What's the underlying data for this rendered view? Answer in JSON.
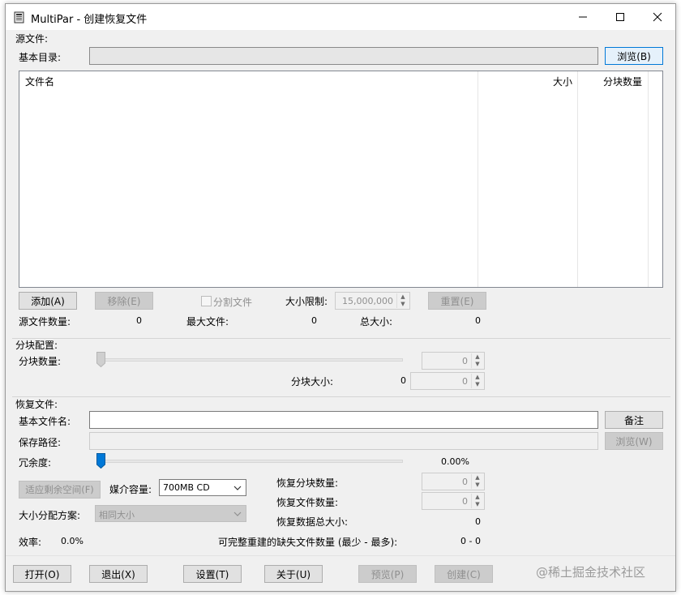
{
  "window": {
    "title": "MultiPar - 创建恢复文件",
    "controls": {
      "minimize": "—",
      "maximize": "☐",
      "close": "✕"
    }
  },
  "source": {
    "section_label": "源文件:",
    "base_dir_label": "基本目录:",
    "base_dir_value": "",
    "browse_button": "浏览(B)",
    "columns": {
      "name": "文件名",
      "size": "大小",
      "blocks": "分块数量"
    },
    "add_button": "添加(A)",
    "remove_button": "移除(E)",
    "split_checkbox_label": "分割文件",
    "size_limit_label": "大小限制:",
    "size_limit_value": "15,000,000",
    "reset_button": "重置(E)",
    "count_label": "源文件数量:",
    "count_value": "0",
    "max_file_label": "最大文件:",
    "max_file_value": "0",
    "total_size_label": "总大小:",
    "total_size_value": "0"
  },
  "blocks": {
    "section_label": "分块配置:",
    "count_label": "分块数量:",
    "count_spin_value": "0",
    "block_size_label": "分块大小:",
    "block_size_value": "0",
    "block_size_spin_value": "0",
    "slider_level": 0
  },
  "recovery": {
    "section_label": "恢复文件:",
    "base_name_label": "基本文件名:",
    "base_name_value": "",
    "note_button": "备注",
    "save_path_label": "保存路径:",
    "save_path_value": "",
    "browse_button": "浏览(W)",
    "redundancy_label": "冗余度:",
    "redundancy_value": "0.00%",
    "redundancy_level": 0,
    "fit_button": "适应剩余空间(F)",
    "media_label": "媒介容量:",
    "media_value": "700MB CD",
    "alloc_label": "大小分配方案:",
    "alloc_value": "相同大小",
    "rec_blocks_label": "恢复分块数量:",
    "rec_blocks_value": "0",
    "rec_files_label": "恢复文件数量:",
    "rec_files_value": "0",
    "rec_total_label": "恢复数据总大小:",
    "rec_total_value": "0",
    "efficiency_label": "效率:",
    "efficiency_value": "0.0%",
    "missing_label": "可完整重建的缺失文件数量 (最少 - 最多):",
    "missing_value": "0 - 0"
  },
  "footer": {
    "open_button": "打开(O)",
    "exit_button": "退出(X)",
    "settings_button": "设置(T)",
    "about_button": "关于(U)",
    "preview_button": "预览(P)",
    "create_button": "创建(C)"
  },
  "watermark": "@稀土掘金技术社区",
  "colors": {
    "accent": "#0078d7",
    "disabled_text": "#8f8f8f",
    "window_bg": "#f0f0f0"
  }
}
